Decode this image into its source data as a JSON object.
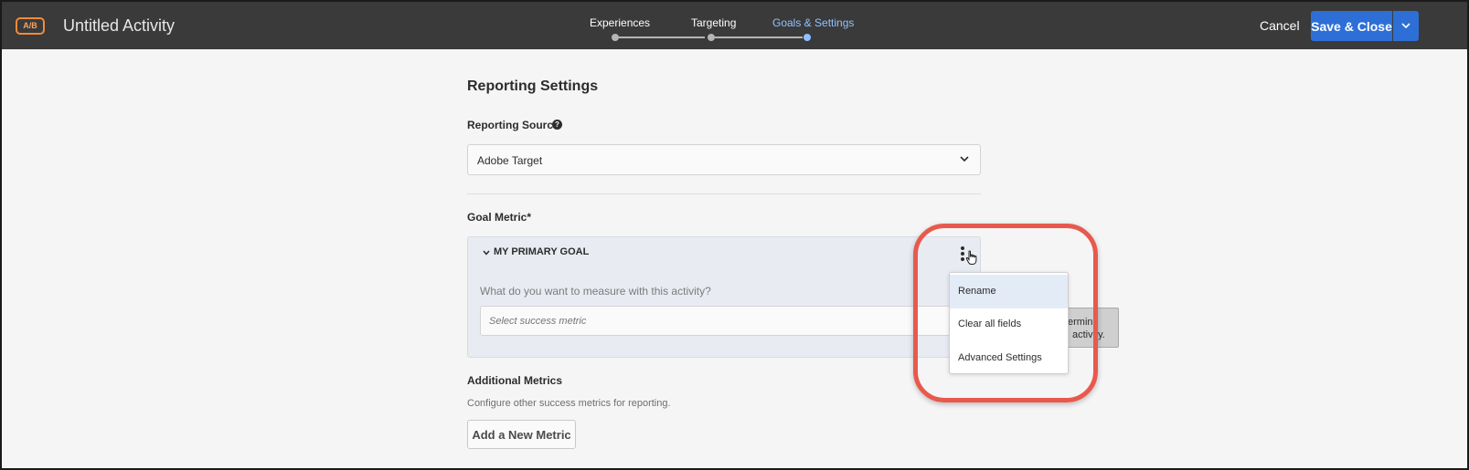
{
  "header": {
    "badge": "A/B",
    "title": "Untitled Activity",
    "steps": [
      {
        "label": "Experiences",
        "active": false
      },
      {
        "label": "Targeting",
        "active": false
      },
      {
        "label": "Goals & Settings",
        "active": true
      }
    ],
    "cancel_label": "Cancel",
    "save_label": "Save & Close"
  },
  "reporting": {
    "heading": "Reporting Settings",
    "source_label": "Reporting Source",
    "source_value": "Adobe Target"
  },
  "goal": {
    "section_label": "Goal Metric*",
    "name": "MY PRIMARY GOAL",
    "question": "What do you want to measure with this activity?",
    "metric_placeholder": "Select success metric",
    "tooltip_line1": "ermine",
    "tooltip_line2": "activity."
  },
  "context_menu": {
    "items": [
      "Rename",
      "Clear all fields",
      "Advanced Settings"
    ]
  },
  "additional": {
    "heading": "Additional Metrics",
    "description": "Configure other success metrics for reporting.",
    "add_button": "Add a New Metric"
  },
  "colors": {
    "header_bg": "#3a3a3a",
    "accent_blue": "#2d6fd6",
    "active_step": "#8fc1ff",
    "highlight_ring": "#e8594d"
  }
}
